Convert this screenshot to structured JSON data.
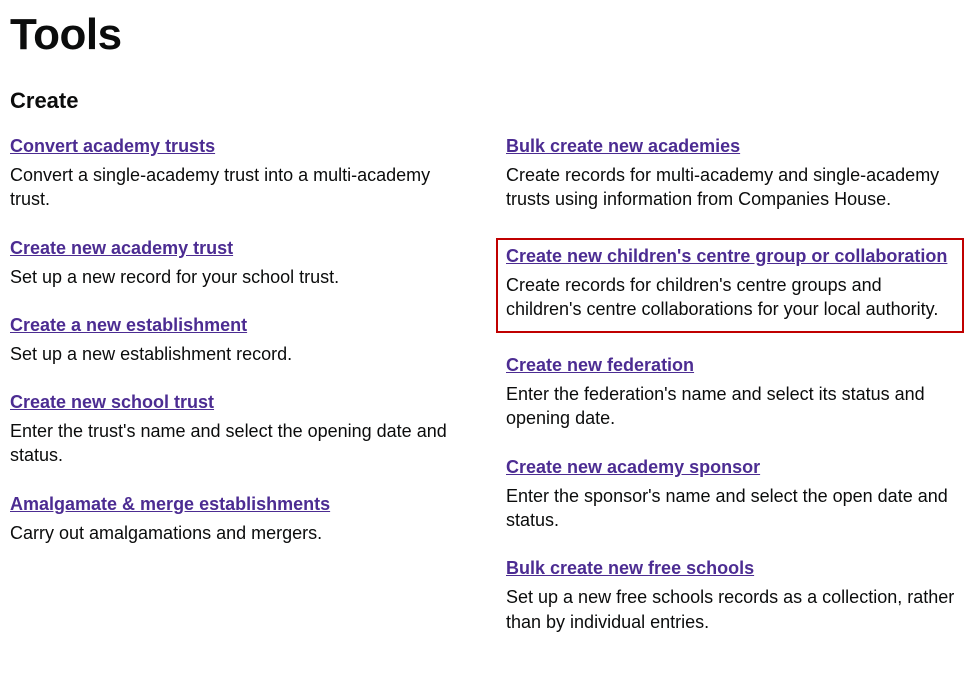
{
  "page": {
    "title": "Tools",
    "section": "Create"
  },
  "left": [
    {
      "title": "Convert academy trusts",
      "desc": "Convert a single-academy trust into a multi-academy trust."
    },
    {
      "title": "Create new academy trust",
      "desc": "Set up a new record for your school trust."
    },
    {
      "title": "Create a new establishment",
      "desc": "Set up a new establishment record."
    },
    {
      "title": "Create new school trust",
      "desc": "Enter the trust's name and select the opening date and status."
    },
    {
      "title": "Amalgamate & merge establishments",
      "desc": "Carry out amalgamations and mergers."
    }
  ],
  "right": [
    {
      "title": "Bulk create new academies",
      "desc": "Create records for multi-academy and single-academy trusts using information from Companies House."
    },
    {
      "title": "Create new children's centre group or collaboration",
      "desc": "Create records for children's centre groups and children's centre collaborations for your local authority."
    },
    {
      "title": "Create new federation",
      "desc": "Enter the federation's name and select its status and opening date."
    },
    {
      "title": "Create new academy sponsor",
      "desc": "Enter the sponsor's name and select the open date and status."
    },
    {
      "title": "Bulk create new free schools",
      "desc": "Set up a new free schools records as a collection, rather than by individual entries."
    }
  ]
}
